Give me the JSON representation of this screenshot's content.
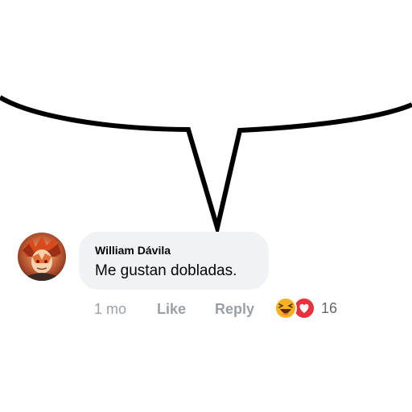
{
  "comment": {
    "author": "William Dávila",
    "text": "Me gustan dobladas.",
    "time": "1 mo",
    "like_label": "Like",
    "reply_label": "Reply",
    "reaction_count": "16",
    "reactions": [
      "haha-icon",
      "love-icon"
    ]
  },
  "colors": {
    "comment_bubble": "#f0f2f5",
    "meta_text": "#9aa0a6",
    "haha": "#f7b125",
    "love": "#e8323b"
  }
}
